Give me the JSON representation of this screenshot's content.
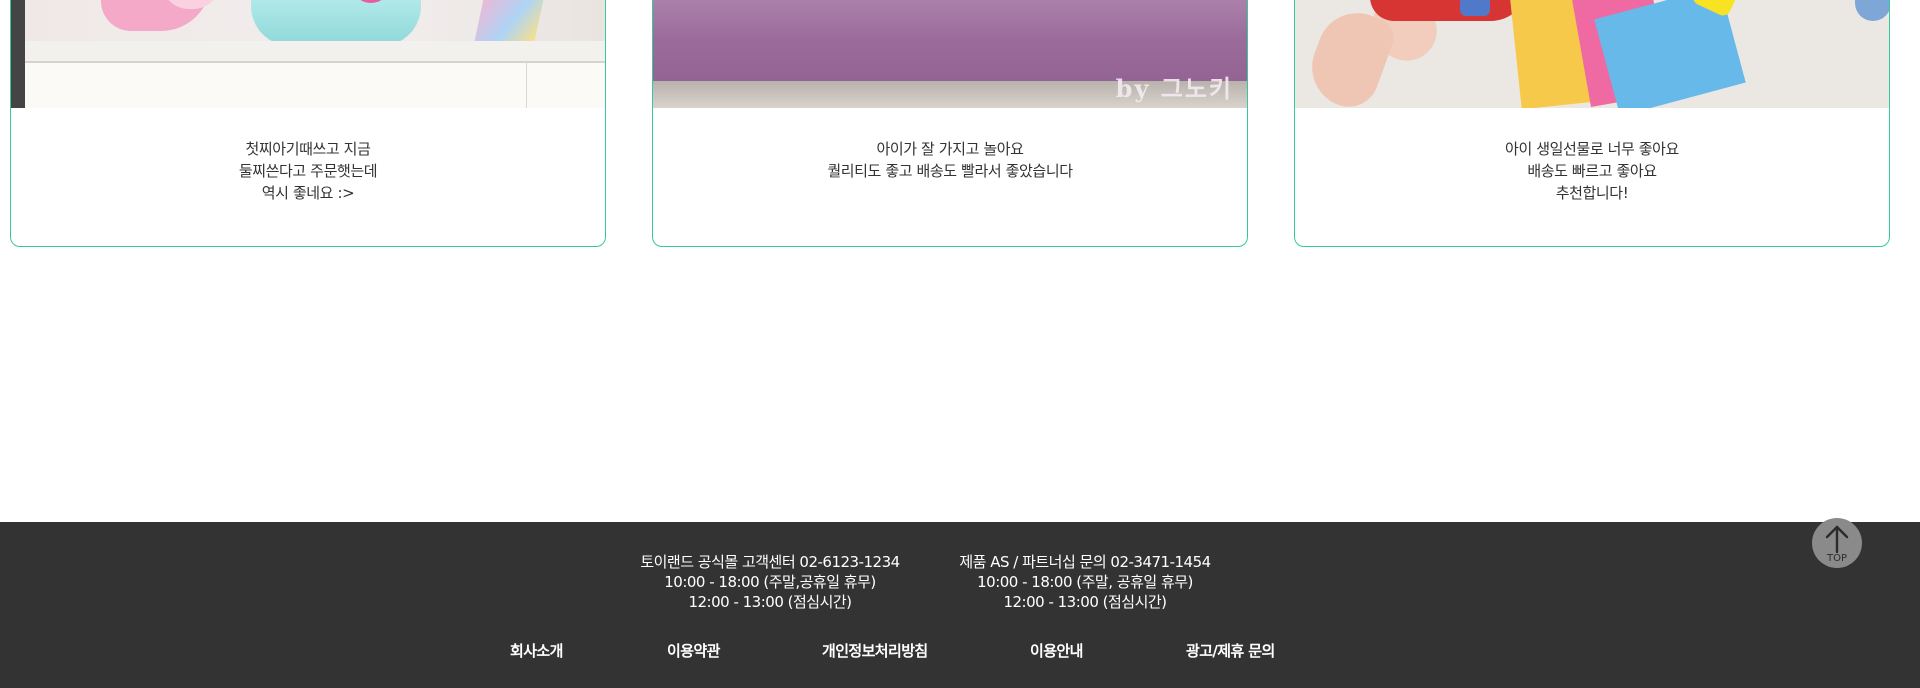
{
  "reviews": [
    {
      "lines": [
        "첫찌아기때쓰고 지금",
        "둘찌쓴다고 주문햇는데",
        "역시 좋네요 :>"
      ]
    },
    {
      "lines": [
        "아이가 잘 가지고 놀아요",
        "퀄리티도 좋고 배송도 빨라서 좋았습니다"
      ],
      "photo_signature": "by 그노키"
    },
    {
      "lines": [
        "아이 생일선물로 너무 좋아요",
        "배송도 빠르고 좋아요",
        "추천합니다!"
      ]
    }
  ],
  "footer": {
    "cs_left": [
      "토이랜드 공식몰 고객센터 02-6123-1234",
      "10:00 - 18:00 (주말,공휴일 휴무)",
      "12:00 - 13:00 (점심시간)"
    ],
    "cs_right": [
      "제품 AS / 파트너십 문의 02-3471-1454",
      "10:00 - 18:00 (주말, 공휴일 휴무)",
      "12:00 - 13:00 (점심시간)"
    ],
    "links": [
      "회사소개",
      "이용약관",
      "개인정보처리방침",
      "이용안내",
      "광고/제휴 문의"
    ]
  },
  "top_button": {
    "label": "TOP",
    "icon": "arrow-up-icon"
  },
  "colors": {
    "card_border": "#36c9a0",
    "footer_bg": "#333333",
    "top_button_bg": "#8a8a8a"
  }
}
